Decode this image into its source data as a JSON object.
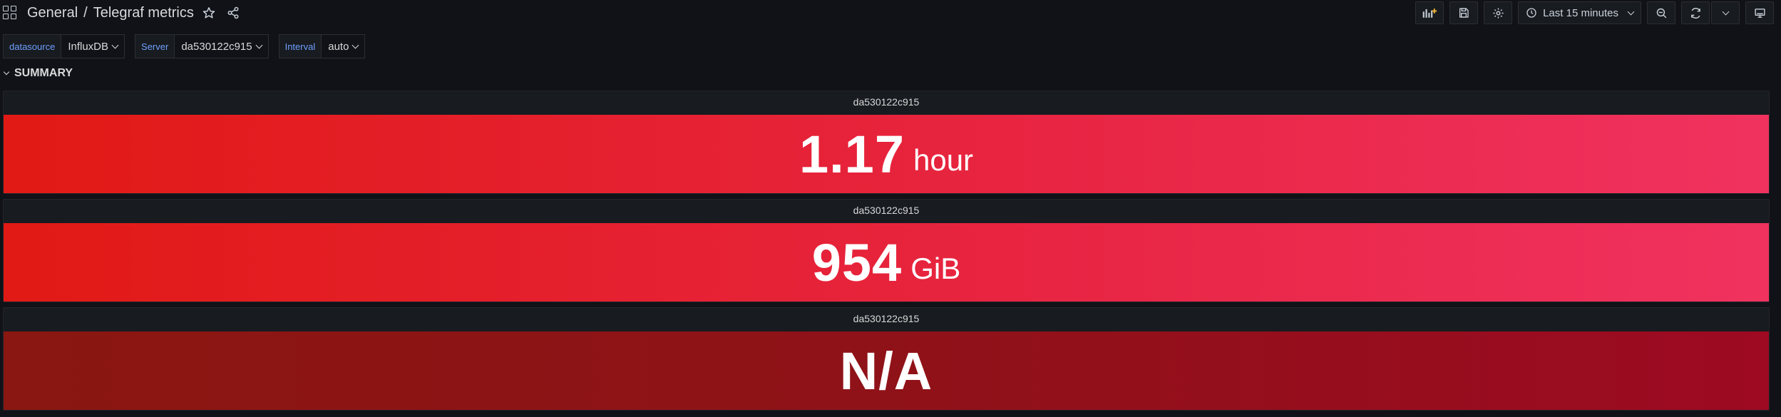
{
  "breadcrumb": {
    "folder": "General",
    "separator": "/",
    "dashboard": "Telegraf metrics"
  },
  "toolbar": {
    "time_range": "Last 15 minutes"
  },
  "variables": [
    {
      "label": "datasource",
      "value": "InfluxDB"
    },
    {
      "label": "Server",
      "value": "da530122c915"
    },
    {
      "label": "Interval",
      "value": "auto"
    }
  ],
  "row": {
    "title": "SUMMARY"
  },
  "panels": [
    {
      "title": "da530122c915",
      "value": "1.17",
      "unit": "hour"
    },
    {
      "title": "da530122c915",
      "value": "954",
      "unit": "GiB"
    },
    {
      "title": "da530122c915",
      "value": "N/A",
      "unit": ""
    }
  ],
  "colors": {
    "background": "#111217",
    "panel": "#181b1f",
    "stat_red": "#e82543",
    "stat_dark_red": "#8f1218",
    "variable_label": "#6e9fff"
  }
}
